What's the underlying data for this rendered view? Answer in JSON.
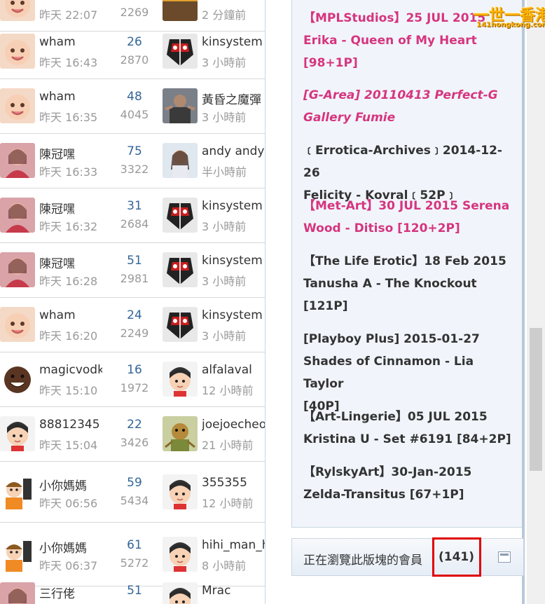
{
  "logo": {
    "text": "一世一香港",
    "domain": "141hongkong.com"
  },
  "threads_left": [
    {
      "author": "",
      "time": "昨天 22:07",
      "replies": "",
      "views": "2269",
      "last_user": "",
      "last_time": "2 分鐘前",
      "avatar": "baby",
      "last_avatar": "photo"
    },
    {
      "author": "wham",
      "time": "昨天 16:43",
      "replies": "26",
      "views": "2870",
      "last_user": "kinsystem",
      "last_time": "3 小時前",
      "avatar": "baby",
      "last_avatar": "robot"
    },
    {
      "author": "wham",
      "time": "昨天 16:35",
      "replies": "48",
      "views": "4045",
      "last_user": "黃昏之魔彈",
      "last_time": "3 小時前",
      "avatar": "baby",
      "last_avatar": "man"
    },
    {
      "author": "陳冠嘿",
      "time": "昨天 16:33",
      "replies": "75",
      "views": "3322",
      "last_user": "andy andy",
      "last_time": "半小時前",
      "avatar": "woman",
      "last_avatar": "girl"
    },
    {
      "author": "陳冠嘿",
      "time": "昨天 16:32",
      "replies": "31",
      "views": "2684",
      "last_user": "kinsystem",
      "last_time": "3 小時前",
      "avatar": "woman",
      "last_avatar": "robot"
    },
    {
      "author": "陳冠嘿",
      "time": "昨天 16:28",
      "replies": "51",
      "views": "2981",
      "last_user": "kinsystem",
      "last_time": "3 小時前",
      "avatar": "woman",
      "last_avatar": "robot"
    },
    {
      "author": "wham",
      "time": "昨天 16:20",
      "replies": "24",
      "views": "2249",
      "last_user": "kinsystem",
      "last_time": "3 小時前",
      "avatar": "baby",
      "last_avatar": "robot"
    },
    {
      "author": "magicvodka",
      "time": "昨天 15:10",
      "replies": "16",
      "views": "1972",
      "last_user": "alfalaval",
      "last_time": "12 小時前",
      "avatar": "man-smile",
      "last_avatar": "cartoon"
    },
    {
      "author": "88812345",
      "time": "昨天 15:04",
      "replies": "22",
      "views": "3426",
      "last_user": "joejoecheor",
      "last_time": "21 小時前",
      "avatar": "cartoon",
      "last_avatar": "toy"
    },
    {
      "author": "小你媽媽",
      "time": "昨天 06:56",
      "replies": "59",
      "views": "5434",
      "last_user": "355355",
      "last_time": "12 小時前",
      "avatar": "cartoon-orange",
      "last_avatar": "cartoon"
    },
    {
      "author": "小你媽媽",
      "time": "昨天 06:37",
      "replies": "61",
      "views": "5272",
      "last_user": "hihi_man_h",
      "last_time": "8 小時前",
      "avatar": "cartoon-orange",
      "last_avatar": "cartoon"
    },
    {
      "author": "三行佬",
      "time": "",
      "replies": "51",
      "views": "",
      "last_user": "Mrac",
      "last_time": "",
      "avatar": "woman",
      "last_avatar": "cartoon"
    }
  ],
  "right_threads": [
    {
      "lines": [
        "【MPLStudios】25 JUL 2015",
        "Erika - Queen of My Heart",
        "[98+1P]"
      ],
      "color": "pink",
      "italic": false
    },
    {
      "lines": [
        "[G-Area] 20110413 Perfect-G",
        "Gallery Fumie"
      ],
      "color": "pink",
      "italic": true
    },
    {
      "lines": [
        "﹝Errotica-Archives﹞2014-12-26",
        "Felicity - Kovral﹝52P﹞"
      ],
      "color": "dark",
      "italic": false
    },
    {
      "lines": [
        "【Met-Art】30 JUL 2015 Serena",
        "Wood - Ditiso [120+2P]"
      ],
      "color": "pink",
      "italic": false
    },
    {
      "lines": [
        "【The Life Erotic】18 Feb 2015",
        "Tanusha A - The Knockout",
        "[121P]"
      ],
      "color": "dark",
      "italic": false
    },
    {
      "lines": [
        "[Playboy Plus] 2015-01-27",
        "Shades of Cinnamon - Lia Taylor",
        "[40P]"
      ],
      "color": "dark",
      "italic": false
    },
    {
      "lines": [
        "【Art-Lingerie】05 JUL 2015",
        "Kristina U - Set #6191 [84+2P]"
      ],
      "color": "dark",
      "italic": false
    },
    {
      "lines": [
        "【RylskyArt】30-Jan-2015",
        "Zelda-Transitus [67+1P]"
      ],
      "color": "dark",
      "italic": false
    }
  ],
  "online": {
    "label": "正在瀏覽此版塊的會員",
    "count": "(141)"
  },
  "colors": {
    "pink": "#d6357f",
    "reply": "#336699",
    "highlight": "#e00000"
  }
}
